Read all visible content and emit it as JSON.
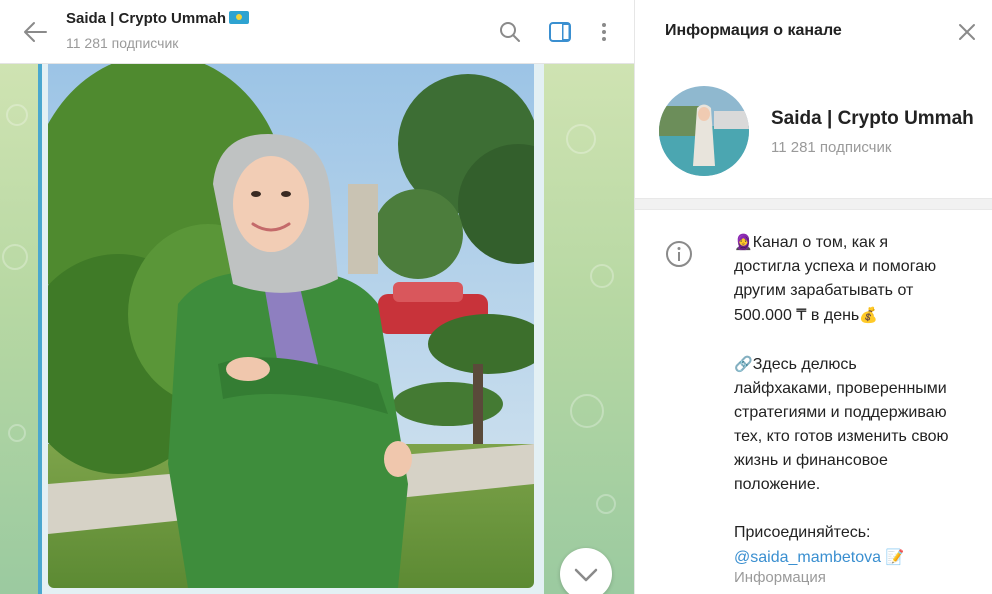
{
  "chat": {
    "title": "Saida | Crypto Ummah",
    "subtitle": "11 281 подписчик"
  },
  "info_panel": {
    "title": "Информация о канале",
    "name": "Saida | Crypto Ummah",
    "subscribers": "11 281 подписчик",
    "description": {
      "line1_emoji": "🧕",
      "line1": "Канал о том, как я",
      "line2": "достигла успеха и помогаю",
      "line3": "другим зарабатывать от",
      "line4": "500.000 ₸ в день",
      "line4_emoji": "💰",
      "line5_emoji": "🔗",
      "line5": "Здесь делюсь",
      "line6": "лайфхаками, проверенными",
      "line7": "стратегиями и поддерживаю",
      "line8": "тех, кто готов изменить свою",
      "line9": "жизнь и финансовое",
      "line10": "положение.",
      "line11": "Присоединяйтесь:",
      "link": "@saida_mambetova",
      "link_emoji": "📝"
    },
    "description_label": "Информация"
  },
  "colors": {
    "accent": "#3a8fd0",
    "chat_bg": "#b7d8a3",
    "photo_frame": "#4aa7cf"
  },
  "icons": [
    "back-arrow-icon",
    "search-icon",
    "side-panel-icon",
    "more-vertical-icon",
    "close-icon",
    "info-icon",
    "chevron-down-icon",
    "kazakhstan-flag-icon"
  ]
}
